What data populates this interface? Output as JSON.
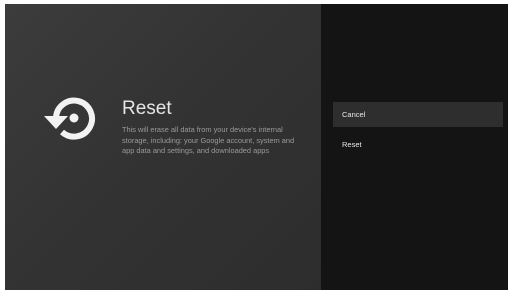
{
  "dialog": {
    "icon": "reset-icon",
    "title": "Reset",
    "description": "This will erase all data from your device's internal storage, including: your Google account, system and app data and settings, and downloaded apps"
  },
  "options": {
    "items": [
      {
        "label": "Cancel",
        "selected": true
      },
      {
        "label": "Reset",
        "selected": false
      }
    ]
  },
  "colors": {
    "left_panel": "#363636",
    "right_panel": "#141414",
    "selected_row": "#2e2e2e",
    "title_text": "#e6e6e6",
    "description_text": "#9a9a9a"
  }
}
